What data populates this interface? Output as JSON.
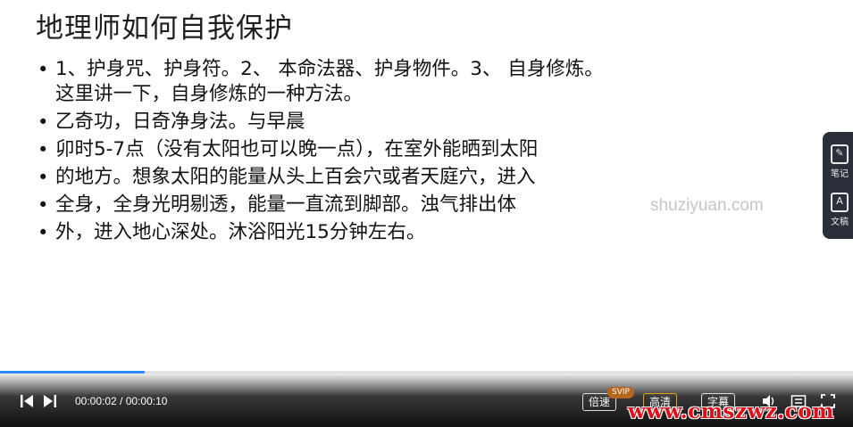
{
  "slide": {
    "title": "地理师如何自我保护",
    "bullets": [
      {
        "line1": "1、护身咒、护身符。2、 本命法器、护身物件。3、 自身修炼。",
        "line2": "这里讲一下，自身修炼的一种方法。"
      },
      {
        "line1": "乙奇功，日奇净身法。与早晨",
        "line2": ""
      },
      {
        "line1": "卯时5-7点（没有太阳也可以晚一点），在室外能晒到太阳",
        "line2": ""
      },
      {
        "line1": "的地方。想象太阳的能量从头上百会穴或者天庭穴，进入",
        "line2": ""
      },
      {
        "line1": "全身，全身光明剔透，能量一直流到脚部。浊气排出体",
        "line2": ""
      },
      {
        "line1": "外，进入地心深处。沐浴阳光15分钟左右。",
        "line2": ""
      }
    ],
    "bullet_symbol": "•",
    "watermark": "shuziyuan.com"
  },
  "side_panel": {
    "note_label": "笔记",
    "doc_label": "文稿"
  },
  "player": {
    "time_current": "00:00:02",
    "time_separator": " / ",
    "time_total": "00:00:10",
    "progress_fraction": 0.17,
    "speed_label": "倍速",
    "svip_label": "SVIP",
    "quality_label": "高清",
    "subtitle_label": "字幕",
    "accent_color": "#2f8cff"
  },
  "watermark_site": "www.cmszwz.com"
}
